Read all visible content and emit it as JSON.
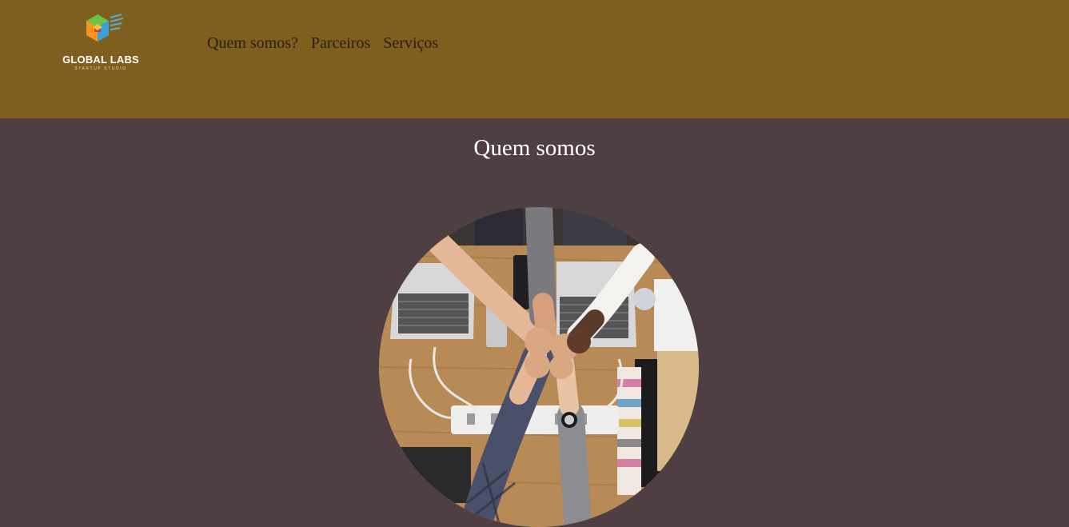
{
  "brand": {
    "name": "GLOBAL LABS",
    "tagline": "STARTUP STUDIO"
  },
  "nav": {
    "items": [
      {
        "label": "Quem somos?"
      },
      {
        "label": "Parceiros"
      },
      {
        "label": "Serviços"
      }
    ]
  },
  "main": {
    "section_title": "Quem somos",
    "image_icon": "team-fist-bump-photo"
  },
  "colors": {
    "header_bg": "#7f5f20",
    "page_bg": "#4f3f42",
    "nav_text": "#2a2110",
    "title_text": "#ffffff"
  }
}
